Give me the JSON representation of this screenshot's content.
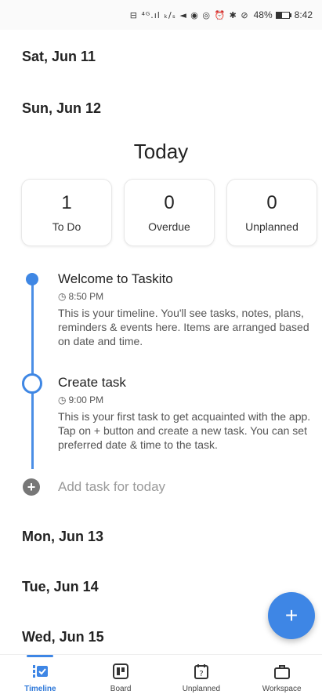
{
  "status_bar": {
    "icons_text": "⊟ ⁴ᴳ.ıl ₖ/ₛ ◄ ◉ ◎ ⏰ ✱ ⊘",
    "battery_percent": "48%",
    "battery_level": 0.48,
    "time": "8:42"
  },
  "dates": {
    "sat": "Sat, Jun 11",
    "sun": "Sun, Jun 12",
    "mon": "Mon, Jun 13",
    "tue": "Tue, Jun 14",
    "wed": "Wed, Jun 15"
  },
  "today": {
    "title": "Today",
    "stats": [
      {
        "count": "1",
        "label": "To Do"
      },
      {
        "count": "0",
        "label": "Overdue"
      },
      {
        "count": "0",
        "label": "Unplanned"
      }
    ]
  },
  "timeline": {
    "entries": [
      {
        "title": "Welcome to Taskito",
        "time": "8:50 PM",
        "description": "This is your timeline. You'll see tasks, notes, plans, reminders & events here. Items are arranged based on date and time."
      },
      {
        "title": "Create task",
        "time": "9:00 PM",
        "description": "This is your first task to get acquainted with the app. Tap on + button and create a new task. You can set preferred date & time to the task."
      }
    ],
    "add_task_label": "Add task for today"
  },
  "fab": {
    "symbol": "+"
  },
  "colors": {
    "accent": "#3e86e5"
  },
  "bottom_nav": {
    "items": [
      {
        "label": "Timeline",
        "icon": "timeline-check-icon",
        "active": true
      },
      {
        "label": "Board",
        "icon": "board-icon",
        "active": false
      },
      {
        "label": "Unplanned",
        "icon": "unplanned-calendar-icon",
        "active": false
      },
      {
        "label": "Workspace",
        "icon": "briefcase-icon",
        "active": false
      }
    ]
  }
}
